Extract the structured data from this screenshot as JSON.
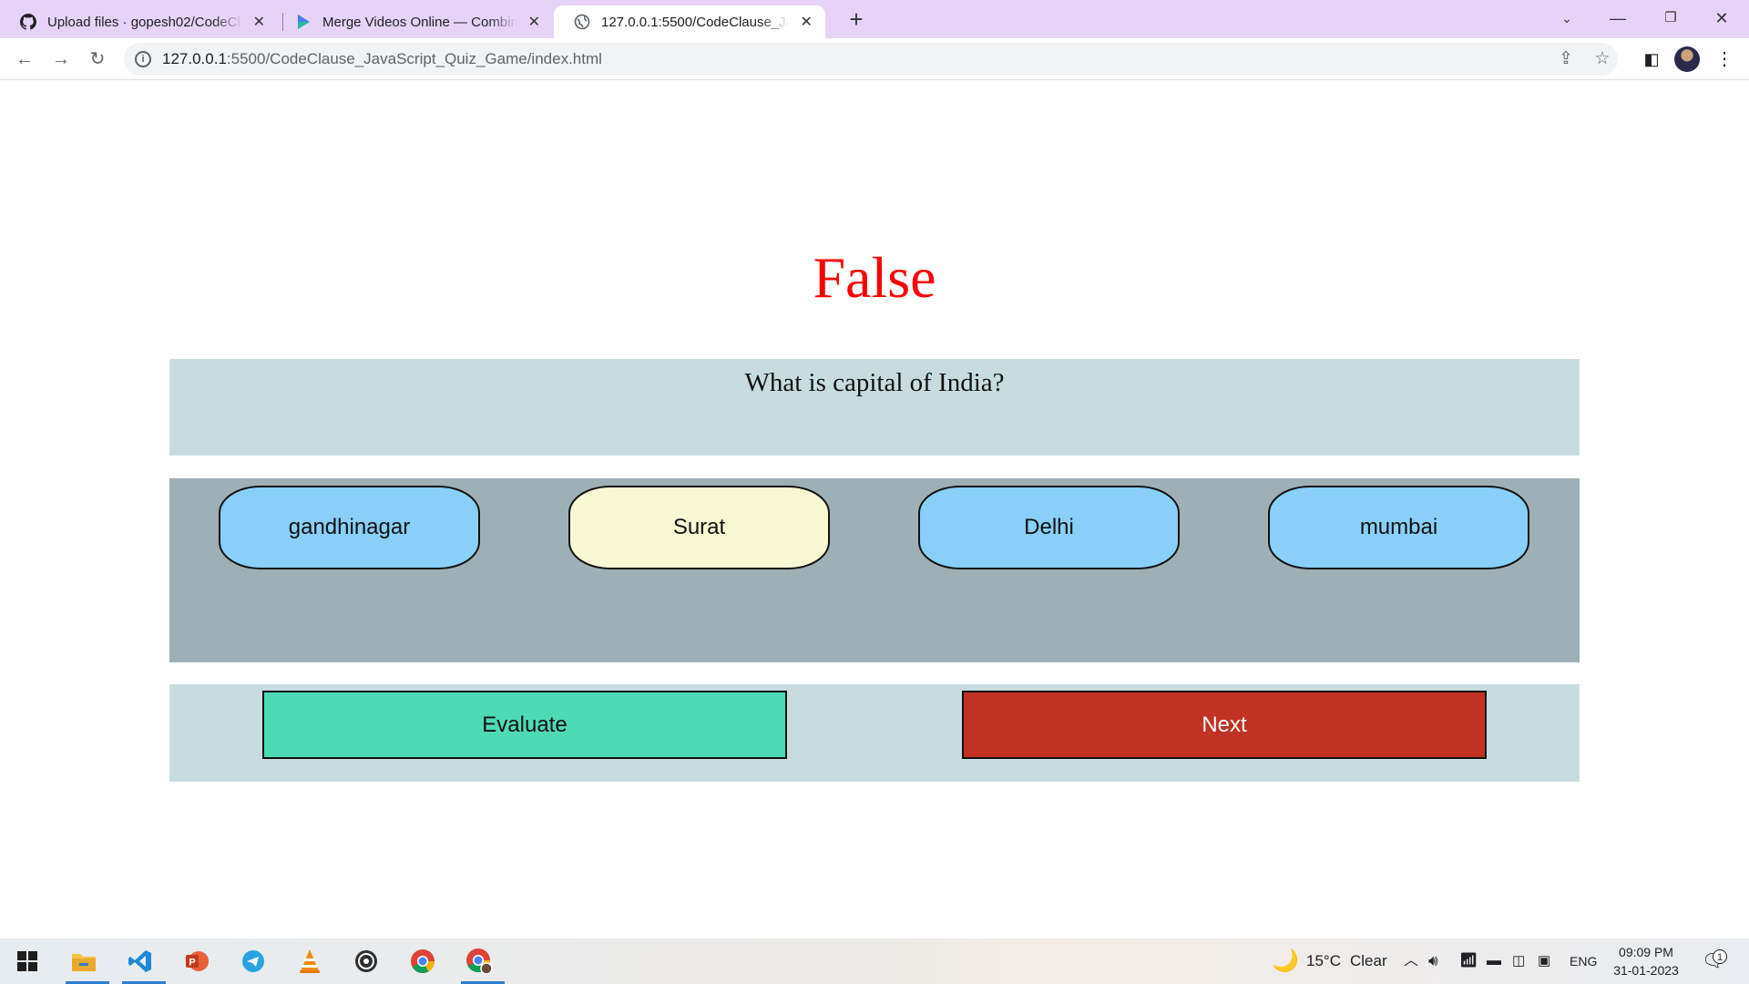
{
  "browser": {
    "tabs": [
      {
        "title": "Upload files · gopesh02/CodeClause",
        "icon": "github-icon",
        "active": false
      },
      {
        "title": "Merge Videos Online — Combine",
        "icon": "play-icon",
        "active": false
      },
      {
        "title": "127.0.0.1:5500/CodeClause_JavaScript",
        "icon": "globe-icon",
        "active": true
      }
    ],
    "new_tab_glyph": "+",
    "url_host": "127.0.0.1",
    "url_rest": ":5500/CodeClause_JavaScript_Quiz_Game/index.html"
  },
  "quiz": {
    "result": "False",
    "result_color": "#ff0000",
    "question": "What is capital of India?",
    "options": [
      {
        "label": "gandhinagar",
        "selected": false
      },
      {
        "label": "Surat",
        "selected": true
      },
      {
        "label": "Delhi",
        "selected": false
      },
      {
        "label": "mumbai",
        "selected": false
      }
    ],
    "evaluate_label": "Evaluate",
    "next_label": "Next",
    "colors": {
      "option_default": "#89cff8",
      "option_selected": "#f9f8d4",
      "evaluate": "#4fdab6",
      "next": "#c03224"
    }
  },
  "taskbar": {
    "apps": [
      "windows-start-icon",
      "file-explorer-icon",
      "vscode-icon",
      "powerpoint-icon",
      "telegram-icon",
      "vlc-icon",
      "obs-icon",
      "chrome-icon",
      "chrome-profile-icon"
    ],
    "weather_temp": "15°C",
    "weather_text": "Clear",
    "language": "ENG",
    "time": "09:09 PM",
    "date": "31-01-2023",
    "notification_count": "1"
  }
}
